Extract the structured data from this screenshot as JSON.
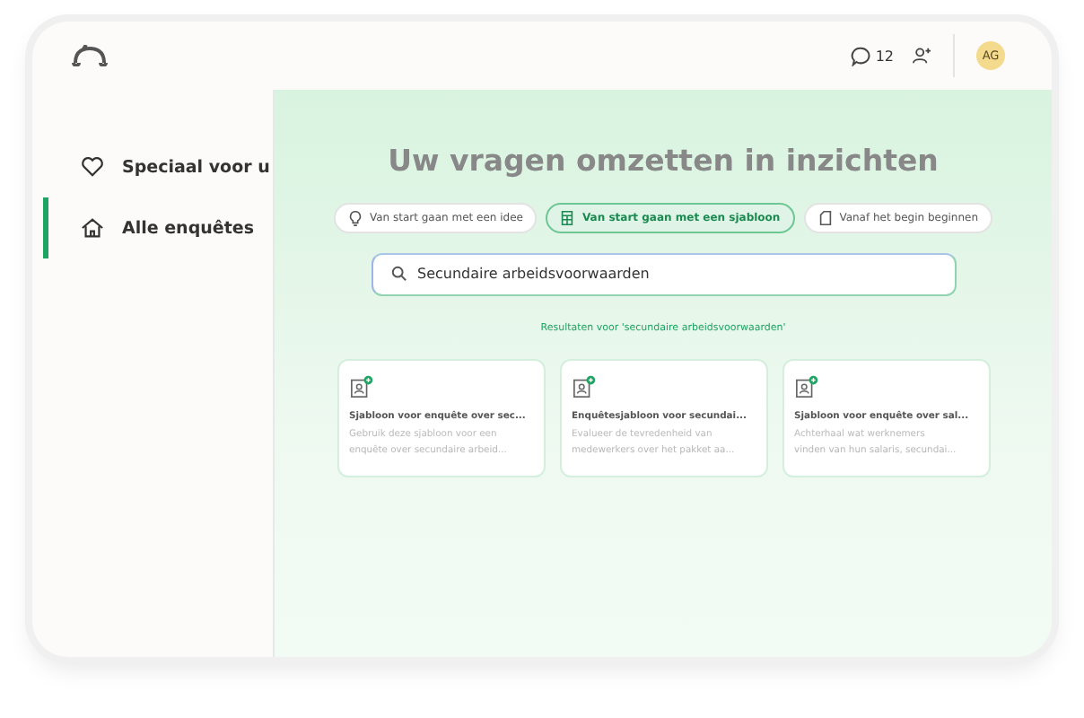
{
  "header": {
    "messages_count": "12",
    "avatar_initials": "AG"
  },
  "sidebar": {
    "items": [
      {
        "label": "Speciaal voor u",
        "selected": false
      },
      {
        "label": "Alle enquêtes",
        "selected": true
      }
    ]
  },
  "main": {
    "title": "Uw vragen omzetten in inzichten",
    "tabs": [
      {
        "label": "Van start gaan met een idee",
        "selected": false
      },
      {
        "label": "Van start gaan met een sjabloon",
        "selected": true
      },
      {
        "label": "Vanaf het begin beginnen",
        "selected": false
      }
    ],
    "search": {
      "value": "Secundaire arbeidsvoorwaarden"
    },
    "results_label": "Resultaten voor 'secundaire arbeidsvoorwaarden'",
    "cards": [
      {
        "title": "Sjabloon voor enquête over sec...",
        "lines": [
          "Gebruik deze sjabloon voor een",
          "enquête over secundaire arbeid..."
        ]
      },
      {
        "title": "Enquêtesjabloon voor secundai...",
        "lines": [
          "Evalueer de tevredenheid van",
          "medewerkers over het pakket aa..."
        ]
      },
      {
        "title": "Sjabloon voor enquête over sal...",
        "lines": [
          "Achterhaal wat werknemers",
          "vinden van hun salaris, secundai..."
        ]
      }
    ]
  }
}
